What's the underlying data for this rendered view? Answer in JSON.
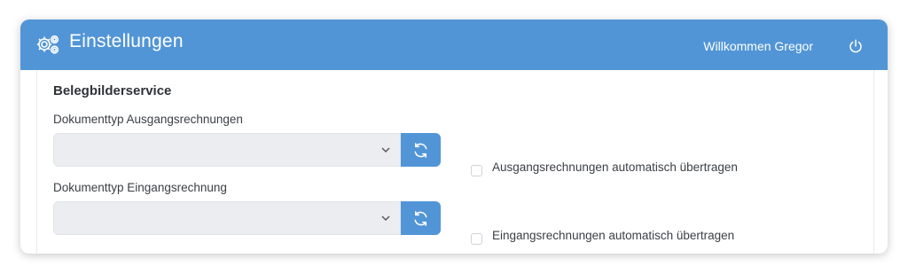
{
  "header": {
    "title": "Einstellungen",
    "icon": "gears-icon",
    "welcome_text": "Willkommen Gregor",
    "power_icon": "power-icon"
  },
  "section": {
    "title": "Belegbilderservice"
  },
  "fields": [
    {
      "label": "Dokumenttyp Ausgangsrechnungen",
      "selected_value": "",
      "checkbox_label": "Ausgangsrechnungen automatisch übertragen",
      "checked": false
    },
    {
      "label": "Dokumenttyp Eingangsrechnung",
      "selected_value": "",
      "checkbox_label": "Eingangsrechnungen automatisch übertragen",
      "checked": false
    }
  ],
  "colors": {
    "accent": "#5195d6",
    "select_bg": "#ebedf0",
    "text": "#3b3f44"
  }
}
